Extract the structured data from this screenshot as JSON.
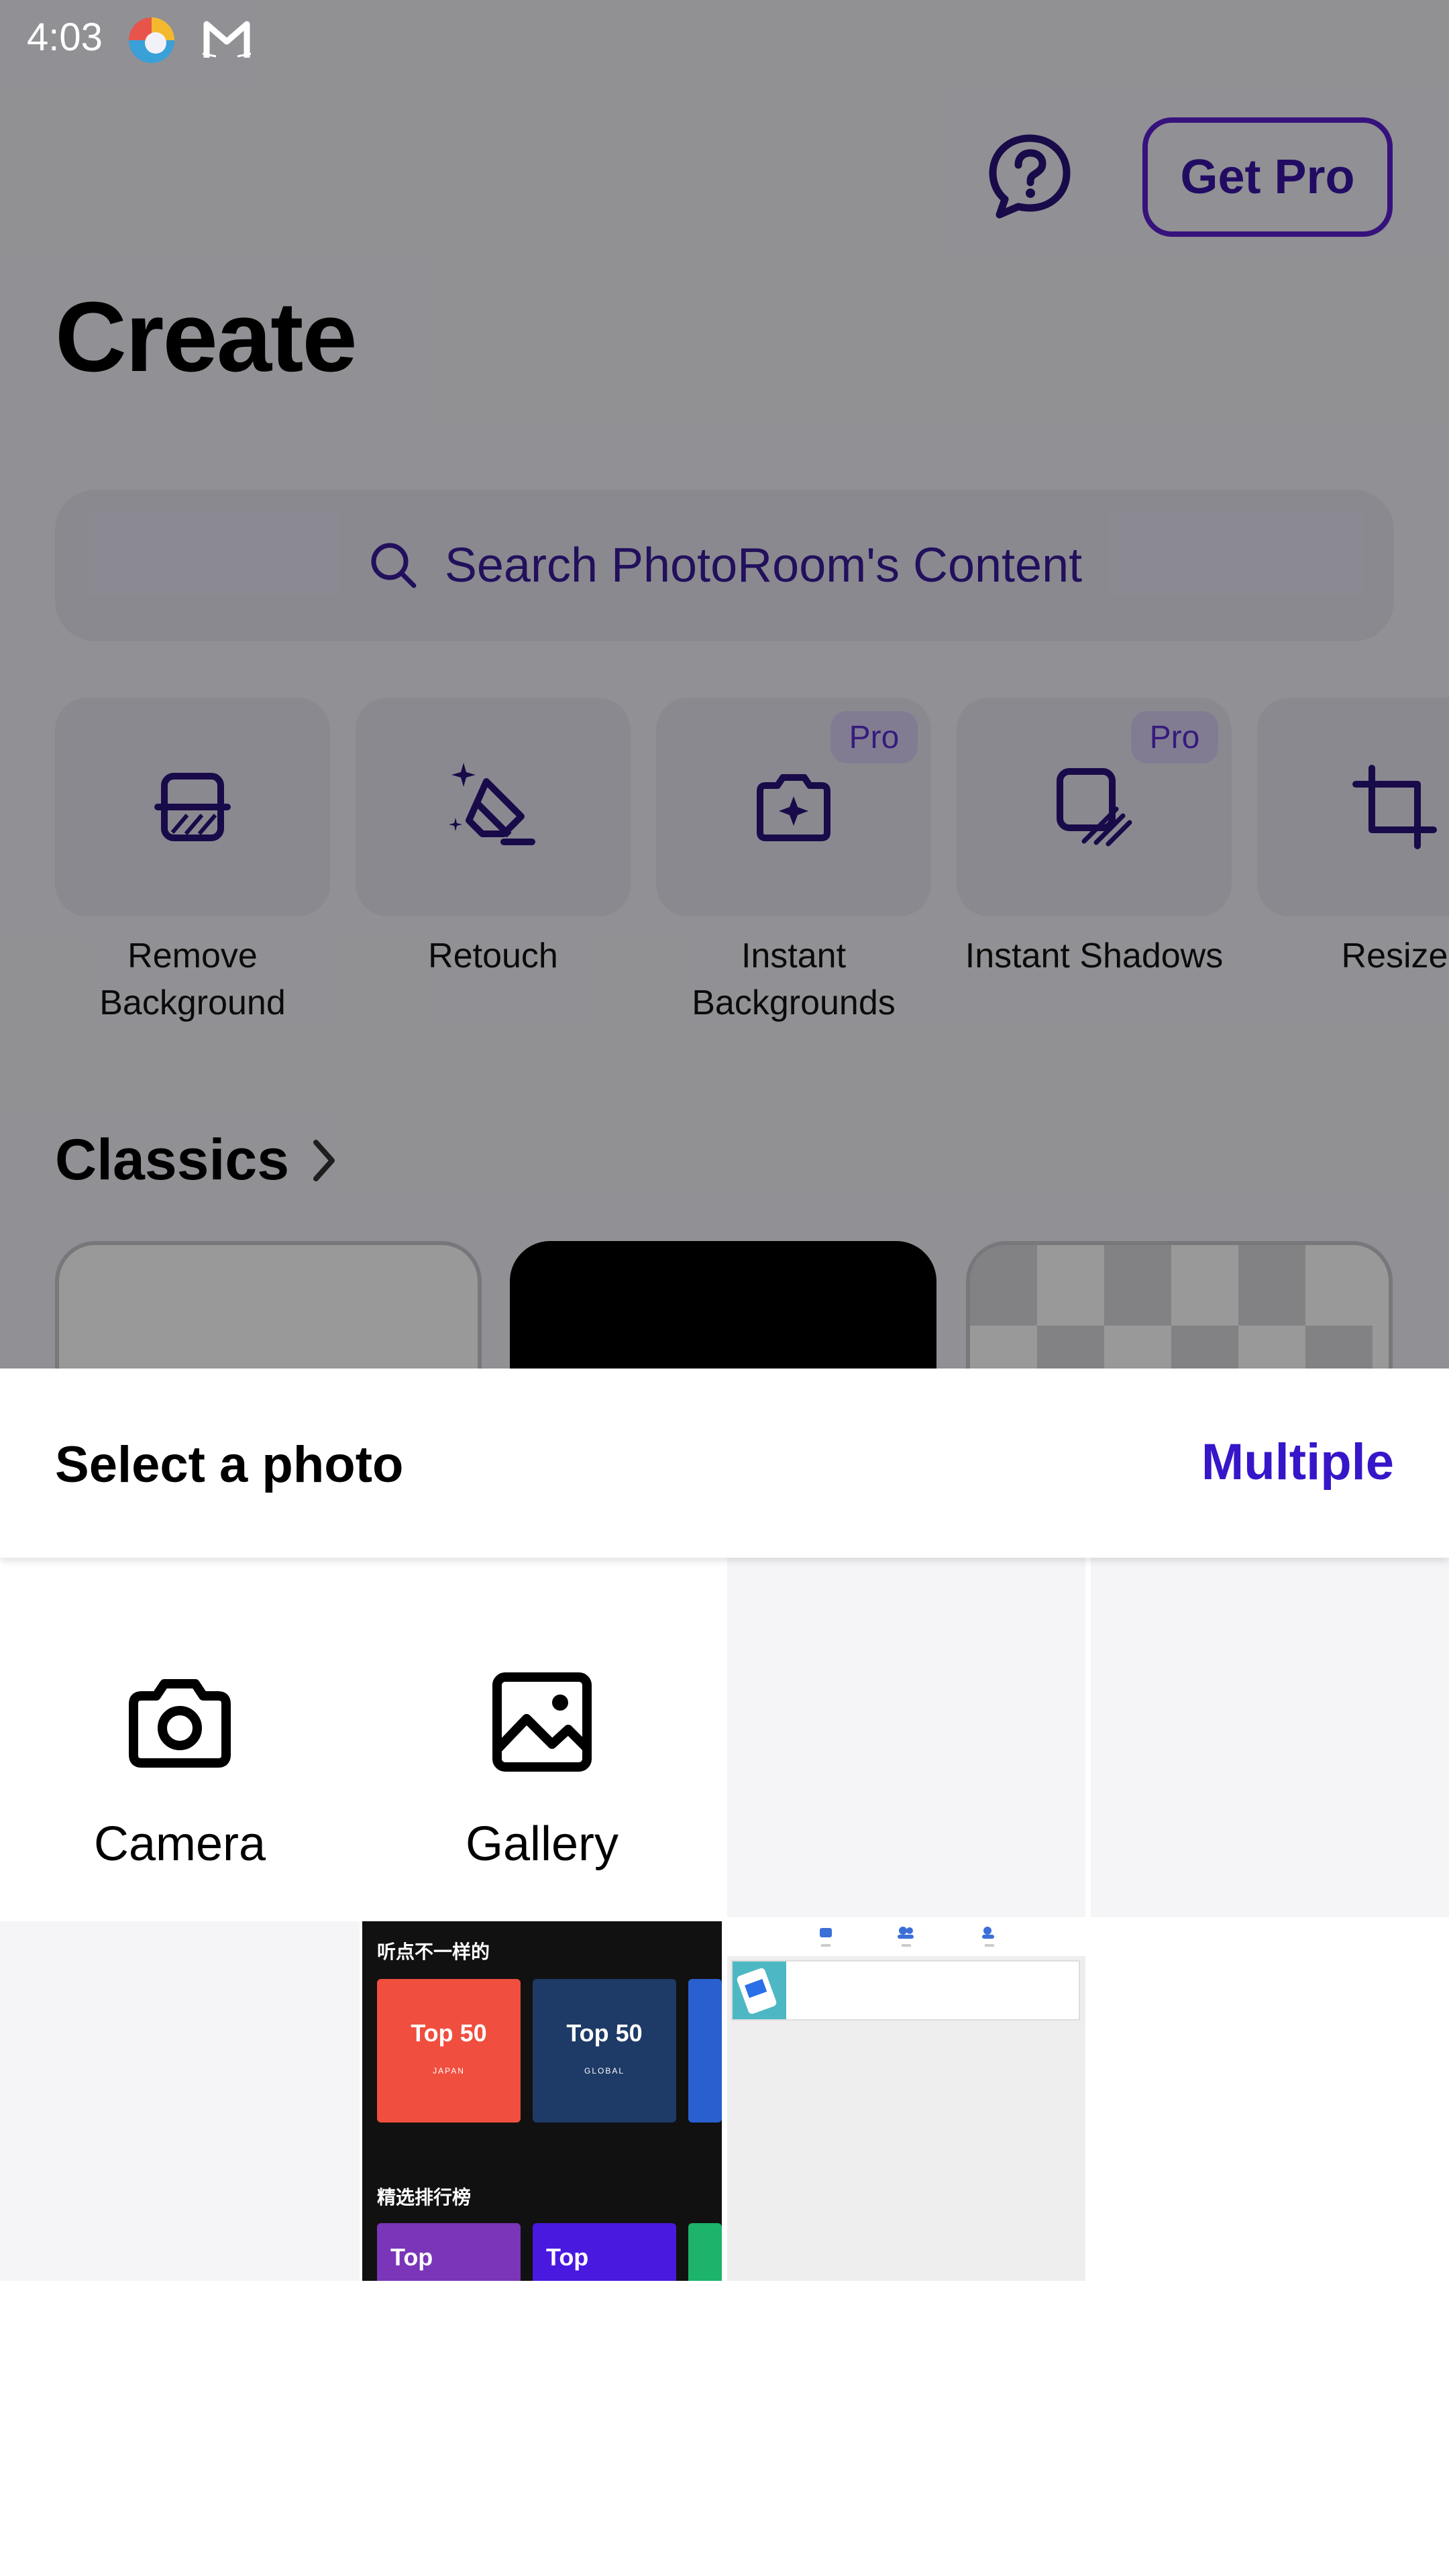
{
  "status_bar": {
    "time": "4:03"
  },
  "header": {
    "get_pro_label": "Get Pro"
  },
  "page": {
    "title": "Create"
  },
  "search": {
    "placeholder": "Search PhotoRoom's Content"
  },
  "tools": [
    {
      "label_line1": "Remove",
      "label_line2": "Background",
      "icon": "remove-background-icon",
      "pro": false
    },
    {
      "label_line1": "Retouch",
      "label_line2": "",
      "icon": "eraser-sparkle-icon",
      "pro": false
    },
    {
      "label_line1": "Instant",
      "label_line2": "Backgrounds",
      "icon": "camera-sparkle-icon",
      "pro": true,
      "badge": "Pro"
    },
    {
      "label_line1": "Instant Shadows",
      "label_line2": "",
      "icon": "shadow-square-icon",
      "pro": true,
      "badge": "Pro"
    },
    {
      "label_line1": "Resize",
      "label_line2": "",
      "icon": "crop-icon",
      "pro": false
    }
  ],
  "classics": {
    "title": "Classics"
  },
  "sheet": {
    "title": "Select a photo",
    "multiple_label": "Multiple",
    "camera_label": "Camera",
    "gallery_label": "Gallery"
  },
  "thumb_music": {
    "heading": "听点不一样的",
    "cards": [
      {
        "title": "Top 50",
        "sub": "JAPAN",
        "color": "#f04e3e"
      },
      {
        "title": "Top 50",
        "sub": "GLOBAL",
        "color": "#1e3a66"
      }
    ],
    "heading2": "精选排行榜",
    "cards2": [
      {
        "title": "Top",
        "color": "#7a35b8"
      },
      {
        "title": "Top",
        "color": "#4a19e0"
      }
    ]
  },
  "colors": {
    "accent": "#3716c9",
    "pro_badge_text": "#5b2dd1",
    "tile_bg": "#e7e5f1",
    "overlay": "rgba(0,0,0,0.40)"
  }
}
